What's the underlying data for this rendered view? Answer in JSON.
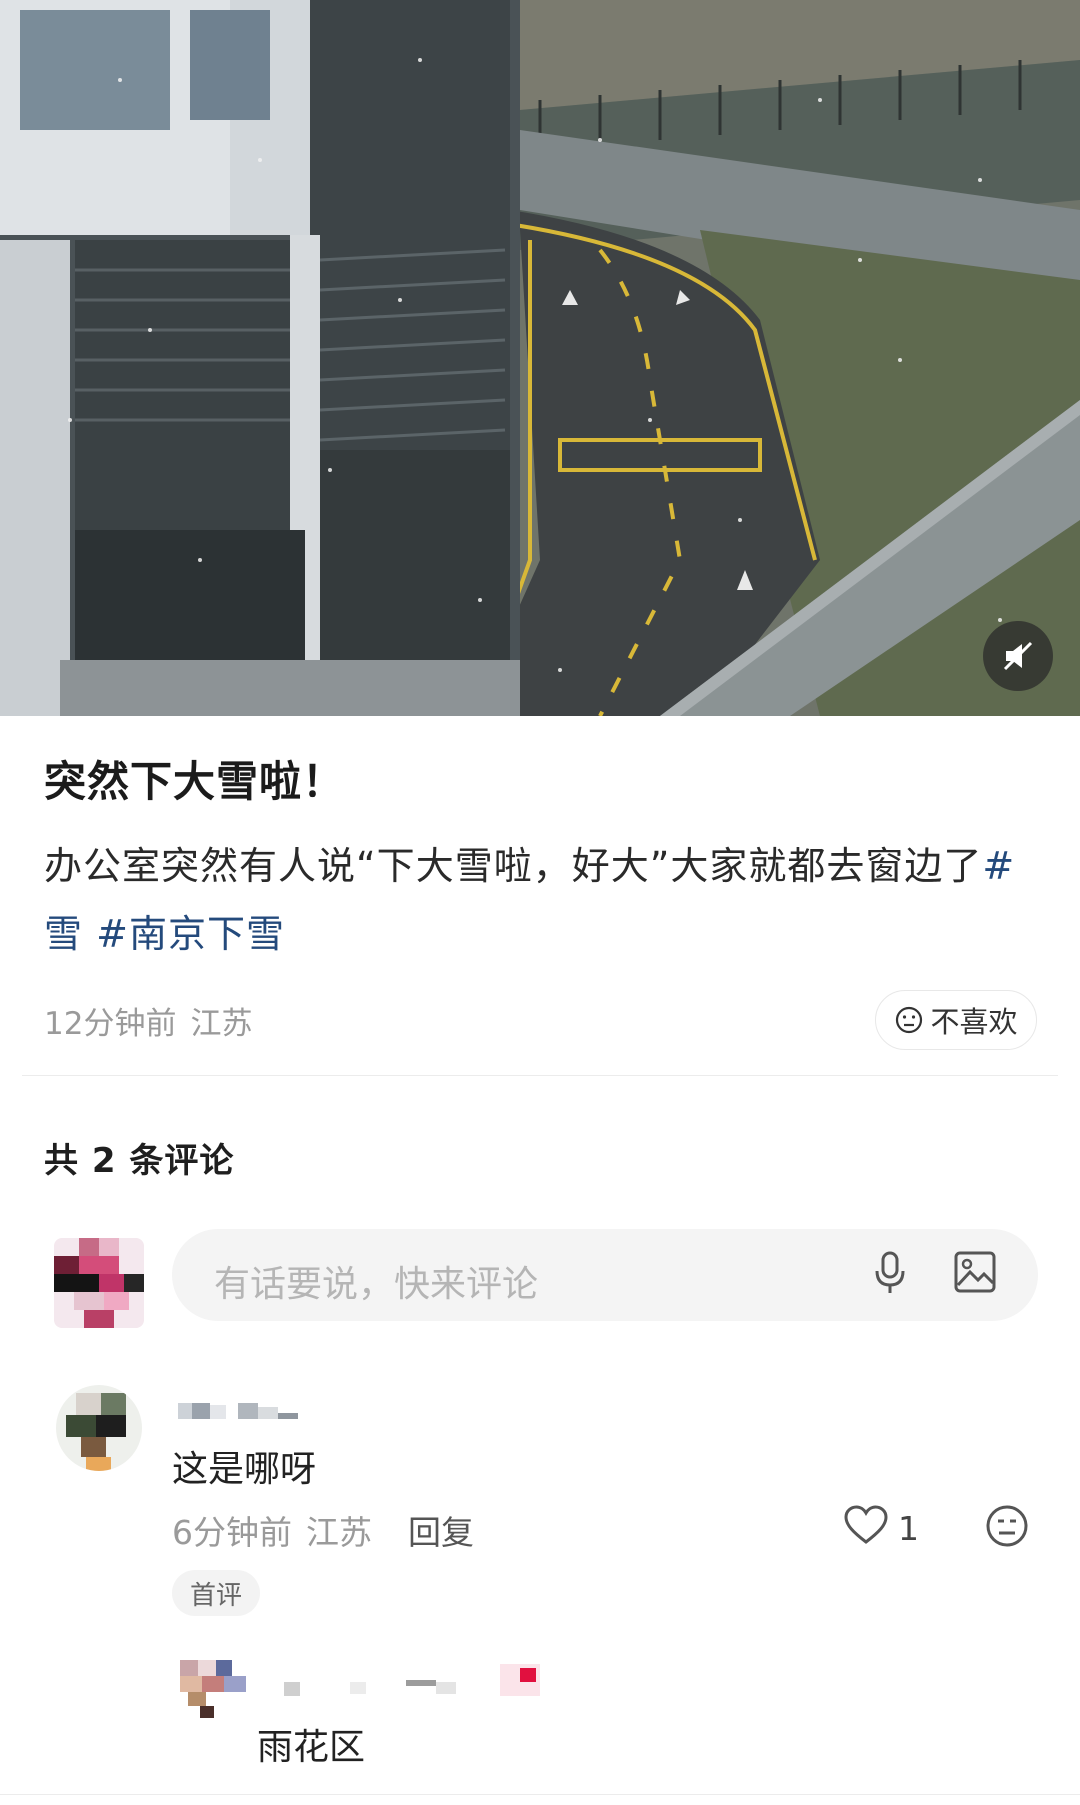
{
  "post": {
    "title": "突然下大雪啦！",
    "body": "办公室突然有人说“下大雪啦，好大”大家就都去窗边了",
    "tags": [
      "#雪",
      "#南京下雪"
    ],
    "time": "12分钟前",
    "location": "江苏",
    "dislike_label": "不喜欢"
  },
  "photo": {
    "mute_icon": "speaker-mute-icon"
  },
  "comments_section": {
    "count_label": "共 2 条评论",
    "input_placeholder": "有话要说，快来评论",
    "mic_icon": "microphone-icon",
    "image_icon": "image-icon"
  },
  "comment": {
    "text": "这是哪呀",
    "time": "6分钟前",
    "location": "江苏",
    "reply_label": "回复",
    "like_count": "1",
    "badge": "首评"
  },
  "reply": {
    "text": "雨花区"
  },
  "colors": {
    "tag": "#244a7c",
    "muted": "#9a9a9a",
    "input_bg": "#f4f4f4"
  }
}
